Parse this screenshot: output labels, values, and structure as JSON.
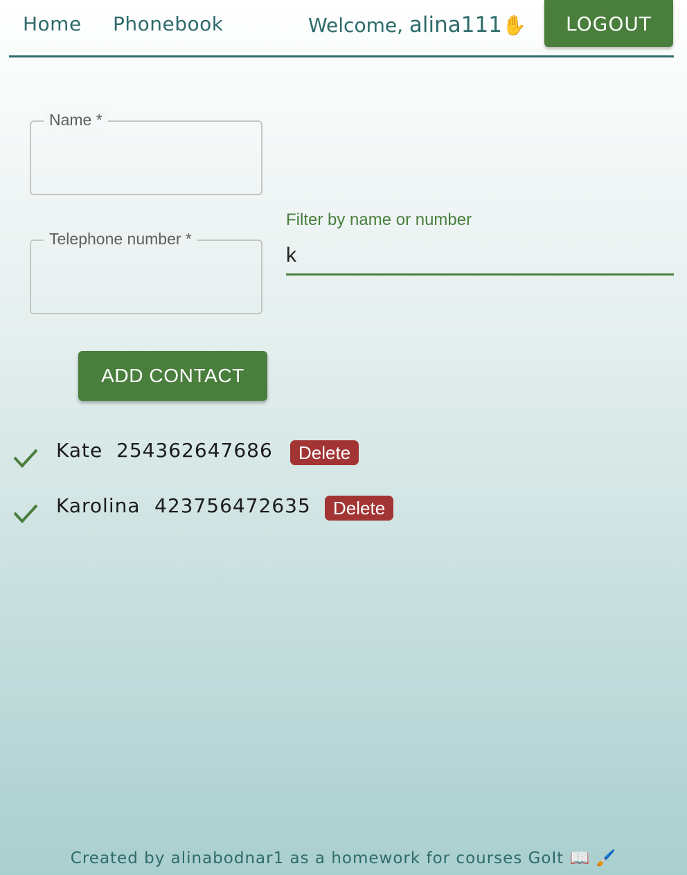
{
  "header": {
    "nav": [
      {
        "label": "Home"
      },
      {
        "label": "Phonebook"
      }
    ],
    "welcome_prefix": "Welcome, ",
    "username": "alina111",
    "welcome_emoji": "✋",
    "logout_label": "LOGOUT"
  },
  "form": {
    "name_label": "Name",
    "name_value": "",
    "phone_label": "Telephone number",
    "phone_value": "",
    "required_mark": "*",
    "submit_label": "ADD CONTACT"
  },
  "filter": {
    "label": "Filter by name or number",
    "value": "k"
  },
  "contacts": [
    {
      "name": "Kate",
      "number": "254362647686",
      "delete_label": "Delete"
    },
    {
      "name": "Karolina",
      "number": "423756472635",
      "delete_label": "Delete"
    }
  ],
  "footer": {
    "text": "Created by alinabodnar1 as a homework for courses GoIt 📖 🖌️"
  },
  "colors": {
    "accent_green": "#4a7e3d",
    "teal_text": "#2e6a6a",
    "delete_red": "#a33434"
  }
}
